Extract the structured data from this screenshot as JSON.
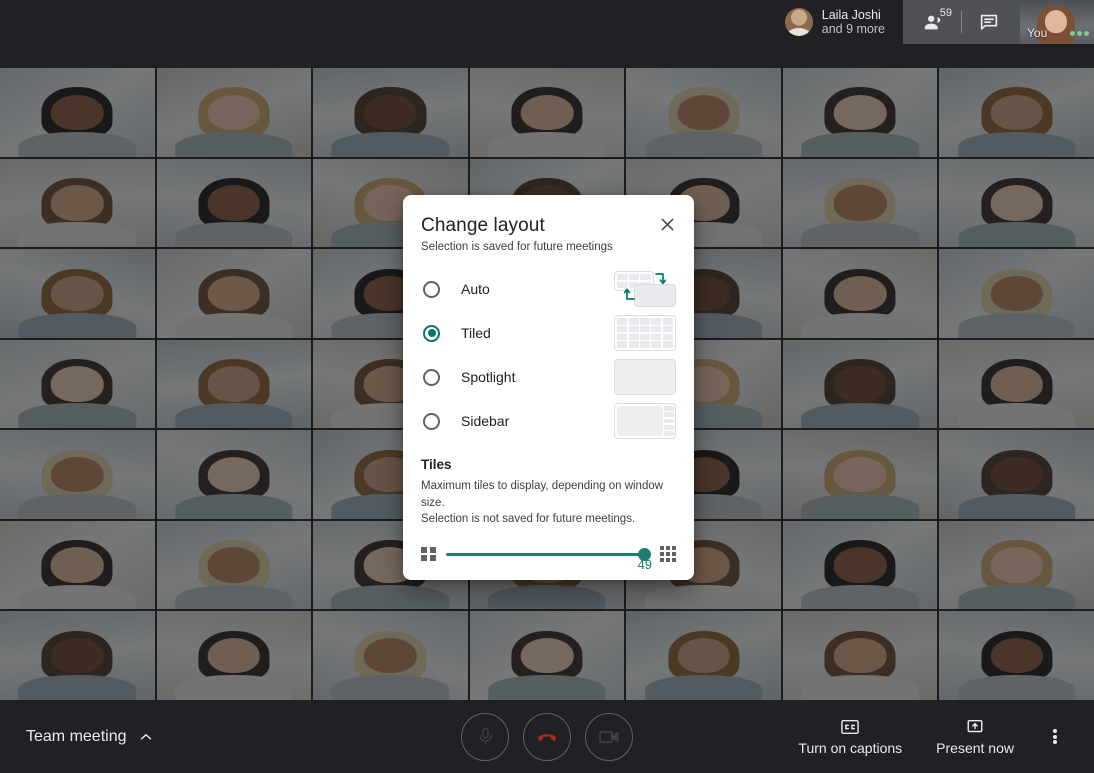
{
  "meta": {
    "app": "Google Meet",
    "accent_color": "#00796b",
    "slider_color": "#1a7f71",
    "dark_surface": "#202124"
  },
  "top_bar": {
    "speaker": {
      "name": "Laila Joshi",
      "subtitle": "and 9 more",
      "avatar_icon": "avatar"
    },
    "participants_icon": "people-icon",
    "participants_count": "59",
    "chat_icon": "chat-icon",
    "self_view": {
      "label": "You",
      "more_icon": "dots-indicator"
    }
  },
  "video_grid": {
    "columns": 7,
    "rows": 7,
    "tile_count": 49
  },
  "dialog": {
    "title": "Change layout",
    "subtitle": "Selection is saved for future meetings",
    "close_icon": "close-icon",
    "options": [
      {
        "label": "Auto",
        "selected": false,
        "thumb": "auto-layout-preview"
      },
      {
        "label": "Tiled",
        "selected": true,
        "thumb": "tiled-layout-preview"
      },
      {
        "label": "Spotlight",
        "selected": false,
        "thumb": "spotlight-layout-preview"
      },
      {
        "label": "Sidebar",
        "selected": false,
        "thumb": "sidebar-layout-preview"
      }
    ],
    "tiles": {
      "heading": "Tiles",
      "description_line1": "Maximum tiles to display, depending on window size.",
      "description_line2": "Selection is not saved for future meetings.",
      "min_icon": "small-grid-icon",
      "max_icon": "large-grid-icon",
      "value": "49",
      "min": "4",
      "max": "49"
    }
  },
  "bottom_bar": {
    "meeting_name": "Team meeting",
    "expand_icon": "chevron-up-icon",
    "controls": [
      {
        "name": "microphone-button",
        "icon": "microphone-icon"
      },
      {
        "name": "end-call-button",
        "icon": "hangup-icon"
      },
      {
        "name": "camera-button",
        "icon": "camera-icon"
      }
    ],
    "captions_label": "Turn on captions",
    "captions_icon": "closed-captions-icon",
    "present_label": "Present now",
    "present_icon": "present-screen-icon",
    "more_icon": "more-vertical-icon"
  }
}
